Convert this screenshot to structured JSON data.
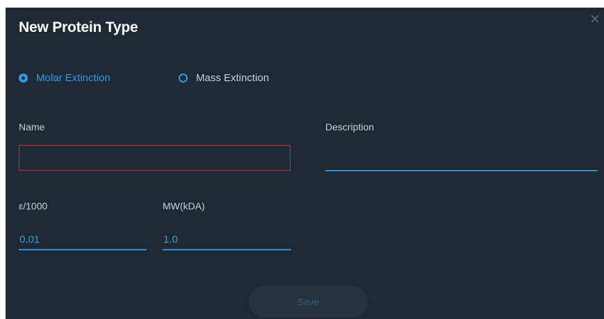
{
  "dialog": {
    "title": "New Protein Type",
    "close_icon": "close-icon"
  },
  "extinction_type": {
    "options": [
      {
        "label": "Molar Extinction",
        "selected": true
      },
      {
        "label": "Mass Extinction",
        "selected": false
      }
    ]
  },
  "fields": {
    "name": {
      "label": "Name",
      "value": ""
    },
    "description": {
      "label": "Description",
      "value": ""
    },
    "epsilon": {
      "label": "ε/1000",
      "value": "0.01"
    },
    "mw": {
      "label": "MW(kDA)",
      "value": "1.0"
    }
  },
  "actions": {
    "save_label": "Save"
  },
  "colors": {
    "background": "#1f2933",
    "accent": "#2d9ce8",
    "error_border": "#d12e2e"
  }
}
